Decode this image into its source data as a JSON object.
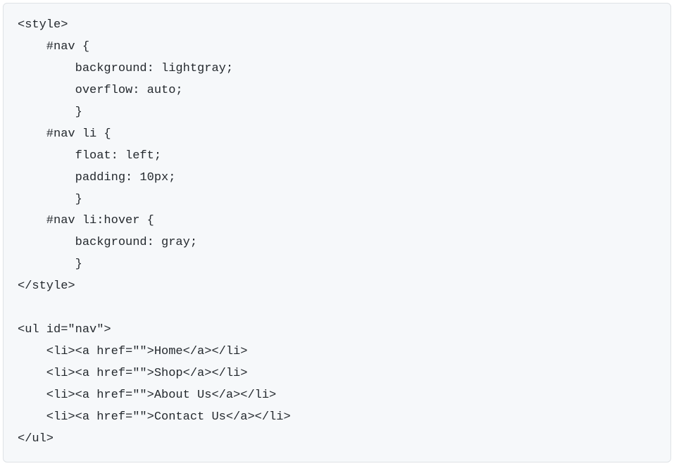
{
  "code": {
    "lines": [
      "<style>",
      "    #nav {",
      "        background: lightgray;",
      "        overflow: auto;",
      "        }",
      "    #nav li {",
      "        float: left;",
      "        padding: 10px;",
      "        }",
      "    #nav li:hover {",
      "        background: gray;",
      "        }",
      "</style>",
      "",
      "<ul id=\"nav\">",
      "    <li><a href=\"\">Home</a></li>",
      "    <li><a href=\"\">Shop</a></li>",
      "    <li><a href=\"\">About Us</a></li>",
      "    <li><a href=\"\">Contact Us</a></li>",
      "</ul>"
    ]
  }
}
